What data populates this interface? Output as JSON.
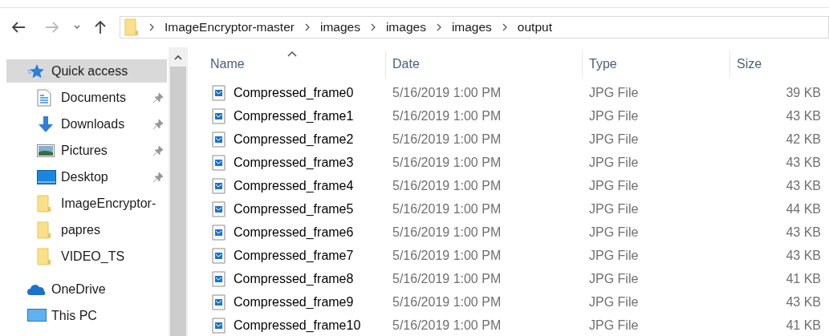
{
  "navigation": {
    "back": {
      "disabled": false
    },
    "forward": {
      "disabled": true
    }
  },
  "address_bar": {
    "breadcrumbs": [
      "ImageEncryptor-master",
      "images",
      "images",
      "images",
      "output"
    ]
  },
  "sidebar": {
    "items": [
      {
        "label": "Quick access",
        "kind": "star",
        "pinned": false,
        "selected": true,
        "children": [
          {
            "label": "Documents",
            "kind": "documents",
            "pinned": true,
            "selected": false
          },
          {
            "label": "Downloads",
            "kind": "download",
            "pinned": true,
            "selected": false
          },
          {
            "label": "Pictures",
            "kind": "pictures",
            "pinned": true,
            "selected": false
          },
          {
            "label": "Desktop",
            "kind": "desktop",
            "pinned": true,
            "selected": false
          },
          {
            "label": "ImageEncryptor-",
            "kind": "folder",
            "pinned": false,
            "selected": false
          },
          {
            "label": "papres",
            "kind": "folder",
            "pinned": false,
            "selected": false
          },
          {
            "label": "VIDEO_TS",
            "kind": "folder",
            "pinned": false,
            "selected": false
          }
        ]
      },
      {
        "label": "OneDrive",
        "kind": "cloud",
        "pinned": false,
        "selected": false
      },
      {
        "label": "This PC",
        "kind": "pc",
        "pinned": false,
        "selected": false
      }
    ]
  },
  "file_list": {
    "columns": [
      {
        "label": "Name",
        "sorted": true
      },
      {
        "label": "Date",
        "sorted": false
      },
      {
        "label": "Type",
        "sorted": false
      },
      {
        "label": "Size",
        "sorted": false
      }
    ],
    "rows": [
      [
        "Compressed_frame0",
        "5/16/2019 1:00 PM",
        "JPG File",
        "39 KB"
      ],
      [
        "Compressed_frame1",
        "5/16/2019 1:00 PM",
        "JPG File",
        "43 KB"
      ],
      [
        "Compressed_frame2",
        "5/16/2019 1:00 PM",
        "JPG File",
        "42 KB"
      ],
      [
        "Compressed_frame3",
        "5/16/2019 1:00 PM",
        "JPG File",
        "43 KB"
      ],
      [
        "Compressed_frame4",
        "5/16/2019 1:00 PM",
        "JPG File",
        "43 KB"
      ],
      [
        "Compressed_frame5",
        "5/16/2019 1:00 PM",
        "JPG File",
        "44 KB"
      ],
      [
        "Compressed_frame6",
        "5/16/2019 1:00 PM",
        "JPG File",
        "43 KB"
      ],
      [
        "Compressed_frame7",
        "5/16/2019 1:00 PM",
        "JPG File",
        "43 KB"
      ],
      [
        "Compressed_frame8",
        "5/16/2019 1:00 PM",
        "JPG File",
        "41 KB"
      ],
      [
        "Compressed_frame9",
        "5/16/2019 1:00 PM",
        "JPG File",
        "43 KB"
      ],
      [
        "Compressed_frame10",
        "5/16/2019 1:00 PM",
        "JPG File",
        "41 KB"
      ]
    ]
  }
}
